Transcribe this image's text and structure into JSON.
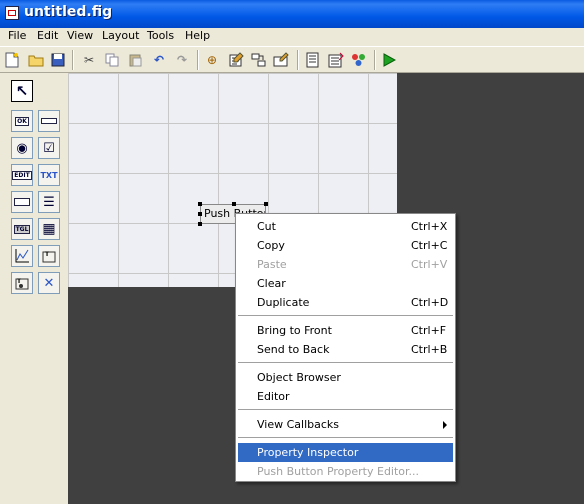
{
  "window": {
    "title": "untitled.fig"
  },
  "menubar": {
    "items": [
      "File",
      "Edit",
      "View",
      "Layout",
      "Tools",
      "Help"
    ]
  },
  "toolbar": {
    "icons": [
      "new-file-icon",
      "open-folder-icon",
      "save-icon",
      "cut-icon",
      "copy-icon",
      "paste-icon",
      "undo-icon",
      "redo-icon",
      "align-objects-icon",
      "menu-editor-icon",
      "tab-order-editor-icon",
      "toolbar-editor-icon",
      "m-file-editor-icon",
      "property-inspector-icon",
      "object-browser-icon",
      "run-icon"
    ]
  },
  "palette": {
    "tools": [
      {
        "name": "select-tool-icon",
        "glyph": "↖"
      },
      {
        "name": "push-button-tool-icon",
        "glyph": "OK"
      },
      {
        "name": "slider-tool-icon",
        "glyph": "▭"
      },
      {
        "name": "radio-button-tool-icon",
        "glyph": "◉"
      },
      {
        "name": "checkbox-tool-icon",
        "glyph": "☑"
      },
      {
        "name": "edit-text-tool-icon",
        "glyph": "EDIT"
      },
      {
        "name": "static-text-tool-icon",
        "glyph": "TXT"
      },
      {
        "name": "popup-menu-tool-icon",
        "glyph": "▭"
      },
      {
        "name": "listbox-tool-icon",
        "glyph": "☰"
      },
      {
        "name": "toggle-button-tool-icon",
        "glyph": "TGL"
      },
      {
        "name": "table-tool-icon",
        "glyph": "▦"
      },
      {
        "name": "axes-tool-icon",
        "glyph": "⌇"
      },
      {
        "name": "panel-tool-icon",
        "glyph": "T"
      },
      {
        "name": "button-group-tool-icon",
        "glyph": "T"
      },
      {
        "name": "activex-tool-icon",
        "glyph": "X"
      }
    ]
  },
  "canvas": {
    "push_button_label": "Push Button"
  },
  "context_menu": {
    "items": [
      {
        "label": "Cut",
        "shortcut": "Ctrl+X",
        "enabled": true
      },
      {
        "label": "Copy",
        "shortcut": "Ctrl+C",
        "enabled": true
      },
      {
        "label": "Paste",
        "shortcut": "Ctrl+V",
        "enabled": false
      },
      {
        "label": "Clear",
        "shortcut": "",
        "enabled": true
      },
      {
        "label": "Duplicate",
        "shortcut": "Ctrl+D",
        "enabled": true
      },
      {
        "label": "Bring to Front",
        "shortcut": "Ctrl+F",
        "enabled": true
      },
      {
        "label": "Send to Back",
        "shortcut": "Ctrl+B",
        "enabled": true
      },
      {
        "label": "Object Browser",
        "shortcut": "",
        "enabled": true
      },
      {
        "label": "Editor",
        "shortcut": "",
        "enabled": true
      },
      {
        "label": "View Callbacks",
        "shortcut": "",
        "enabled": true,
        "submenu": true
      },
      {
        "label": "Property Inspector",
        "shortcut": "",
        "enabled": true,
        "highlighted": true
      },
      {
        "label": "Push Button Property Editor...",
        "shortcut": "",
        "enabled": false
      }
    ]
  },
  "colors": {
    "highlight": "#316ac5",
    "titlebar": "#0058e6",
    "workspace": "#404040"
  }
}
